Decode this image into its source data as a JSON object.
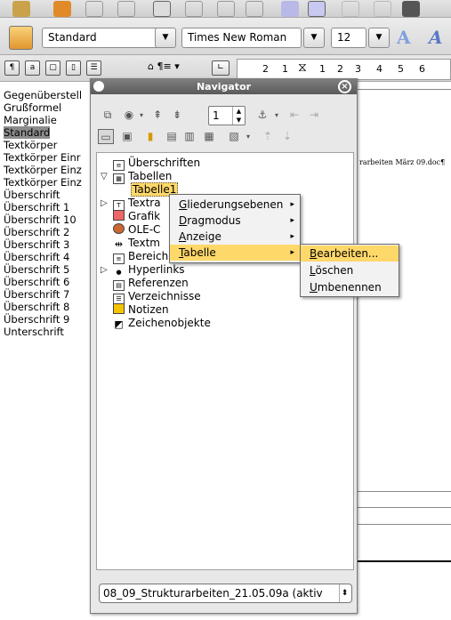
{
  "format_toolbar": {
    "paragraph_style": "Standard",
    "font_name": "Times New Roman",
    "font_size": "12"
  },
  "ruler": {
    "ticks": [
      "2",
      "1",
      "1",
      "2",
      "3",
      "4",
      "5",
      "6"
    ]
  },
  "styles": [
    "Gegenüberstell",
    "Grußformel",
    "Marginalie",
    "Standard",
    "Textkörper",
    "Textkörper Einr",
    "Textkörper Einz",
    "Textkörper Einz",
    "Überschrift",
    "Überschrift 1",
    "Überschrift 10",
    "Überschrift 2",
    "Überschrift 3",
    "Überschrift 4",
    "Überschrift 5",
    "Überschrift 6",
    "Überschrift 7",
    "Überschrift 8",
    "Überschrift 9",
    "Unterschrift"
  ],
  "document": {
    "header_text": "rarbeiten März 09.doc¶"
  },
  "navigator": {
    "title": "Navigator",
    "page_number": "1",
    "tree": {
      "headings": "Überschriften",
      "tables": "Tabellen",
      "table1": "Tabelle1",
      "textframes": "Textra",
      "graphics": "Grafik",
      "ole": "OLE-C",
      "textmarks": "Textm",
      "sections": "Bereiche",
      "hyperlinks": "Hyperlinks",
      "references": "Referenzen",
      "indexes": "Verzeichnisse",
      "notes": "Notizen",
      "drawings": "Zeichenobjekte"
    },
    "document_selector": "08_09_Strukturarbeiten_21.05.09a (aktiv"
  },
  "context_menu": {
    "items": [
      {
        "u": "G",
        "rest": "liederungsebenen"
      },
      {
        "u": "D",
        "rest": "ragmodus"
      },
      {
        "u": "A",
        "rest": "nzeige"
      },
      {
        "u": "T",
        "rest": "abelle"
      }
    ]
  },
  "submenu": {
    "items": [
      {
        "u": "B",
        "rest": "earbeiten..."
      },
      {
        "u": "L",
        "rest": "öschen"
      },
      {
        "u": "U",
        "rest": "mbenennen"
      }
    ]
  },
  "colors": {
    "highlight": "#ffd86a",
    "title_bar": "#6a6a6a"
  }
}
